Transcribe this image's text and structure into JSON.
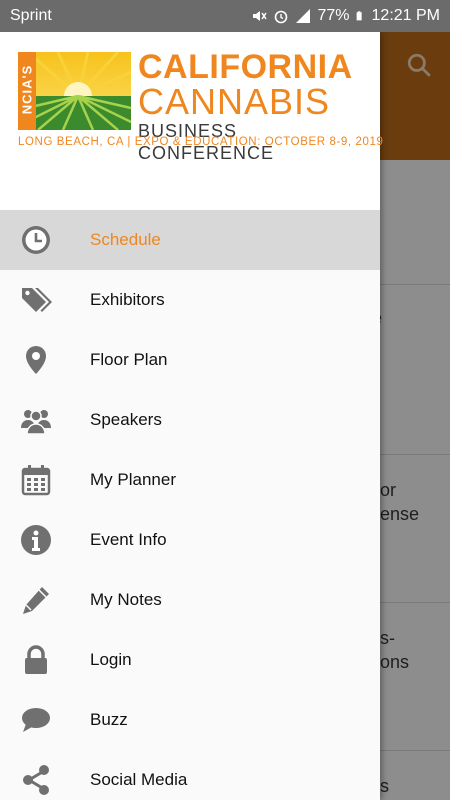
{
  "status_bar": {
    "carrier": "Sprint",
    "battery": "77%",
    "time": "12:21 PM"
  },
  "header": {
    "logo_ncia": "NCIA'S",
    "logo_line1": "CALIFORNIA",
    "logo_line2": "CANNABIS",
    "logo_line3": "BUSINESS CONFERENCE",
    "tagline": "LONG BEACH, CA | EXPO & EDUCATION: OCTOBER 8-9, 2019"
  },
  "menu": {
    "items": [
      {
        "label": "Schedule",
        "icon": "clock-icon",
        "active": true
      },
      {
        "label": "Exhibitors",
        "icon": "tags-icon"
      },
      {
        "label": "Floor Plan",
        "icon": "map-pin-icon"
      },
      {
        "label": "Speakers",
        "icon": "users-icon"
      },
      {
        "label": "My Planner",
        "icon": "calendar-icon"
      },
      {
        "label": "Event Info",
        "icon": "info-icon"
      },
      {
        "label": "My Notes",
        "icon": "pencil-icon"
      },
      {
        "label": "Login",
        "icon": "lock-icon"
      },
      {
        "label": "Buzz",
        "icon": "chat-bubble-icon"
      },
      {
        "label": "Social Media",
        "icon": "share-icon"
      }
    ]
  },
  "background": {
    "snippets": [
      "e",
      "or",
      "ense",
      "s-",
      "ons",
      "s"
    ]
  },
  "colors": {
    "accent": "#f0861e",
    "toolbar": "#8b4f13",
    "active_row": "#d8d8d8"
  }
}
